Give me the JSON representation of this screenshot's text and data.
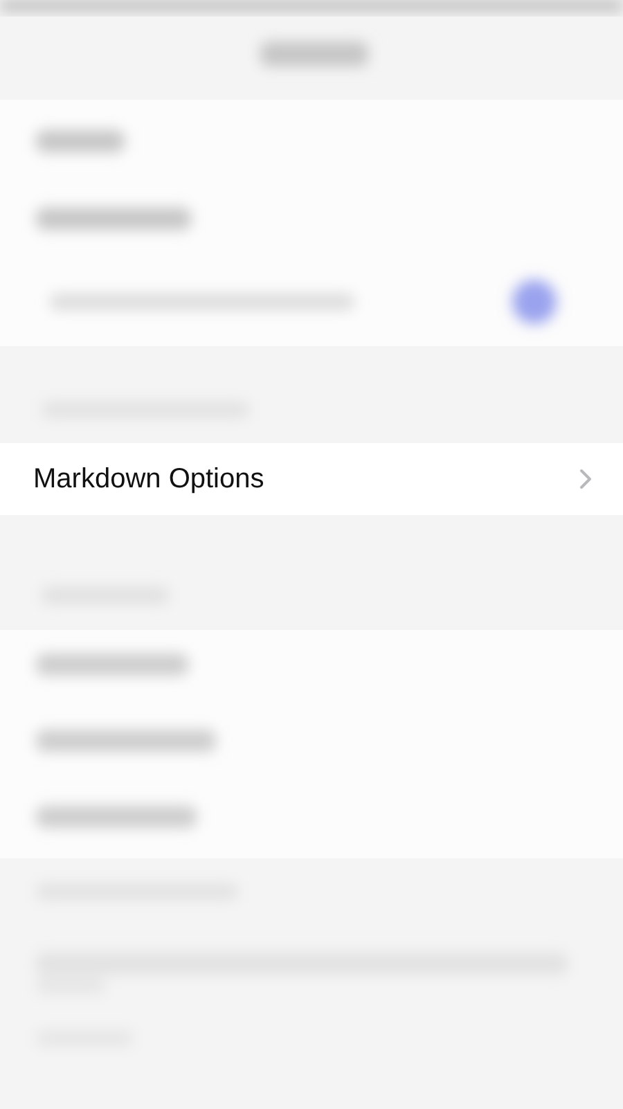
{
  "focused_row": {
    "label": "Markdown Options"
  }
}
